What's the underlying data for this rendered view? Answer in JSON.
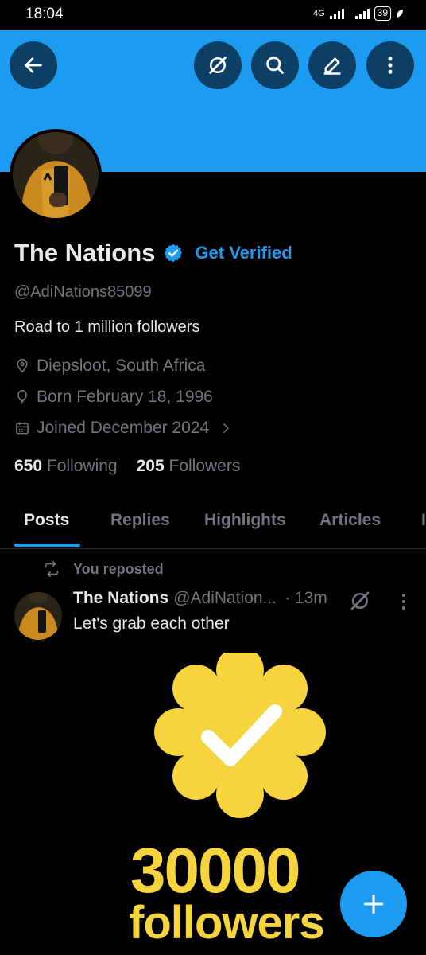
{
  "status_bar": {
    "time": "18:04",
    "network": "4G",
    "battery": "39"
  },
  "header": {
    "banner_color": "#1d9bf0",
    "buttons": [
      {
        "icon": "back-arrow-icon"
      },
      {
        "icon": "grok-icon"
      },
      {
        "icon": "search-icon"
      },
      {
        "icon": "edit-icon"
      },
      {
        "icon": "more-vertical-icon"
      }
    ]
  },
  "profile": {
    "display_name": "The Nations",
    "verified_badge": "verified-badge-icon",
    "get_verified_label": "Get Verified",
    "handle": "@AdiNations85099",
    "bio": "Road to 1 million followers",
    "location": "Diepsloot, South Africa",
    "birthday": "Born February 18, 1996",
    "joined": "Joined December 2024",
    "following_count": "650",
    "following_label": "Following",
    "followers_count": "205",
    "followers_label": "Followers"
  },
  "tabs": [
    {
      "label": "Posts",
      "active": true
    },
    {
      "label": "Replies",
      "active": false
    },
    {
      "label": "Highlights",
      "active": false
    },
    {
      "label": "Articles",
      "active": false
    }
  ],
  "post": {
    "repost_label": "You reposted",
    "author_name": "The Nations",
    "author_handle": "@AdiNation...",
    "time": "· 13m",
    "text": "Let's grab each other",
    "media": {
      "number": "30000",
      "word": "followers",
      "badge_color": "#f5d43d"
    }
  },
  "fab": {
    "icon": "plus-icon"
  },
  "colors": {
    "accent": "#1d9bf0",
    "background": "#000000",
    "text_primary": "#e7e9ea",
    "text_secondary": "#71767b",
    "divider": "#2f3336"
  }
}
